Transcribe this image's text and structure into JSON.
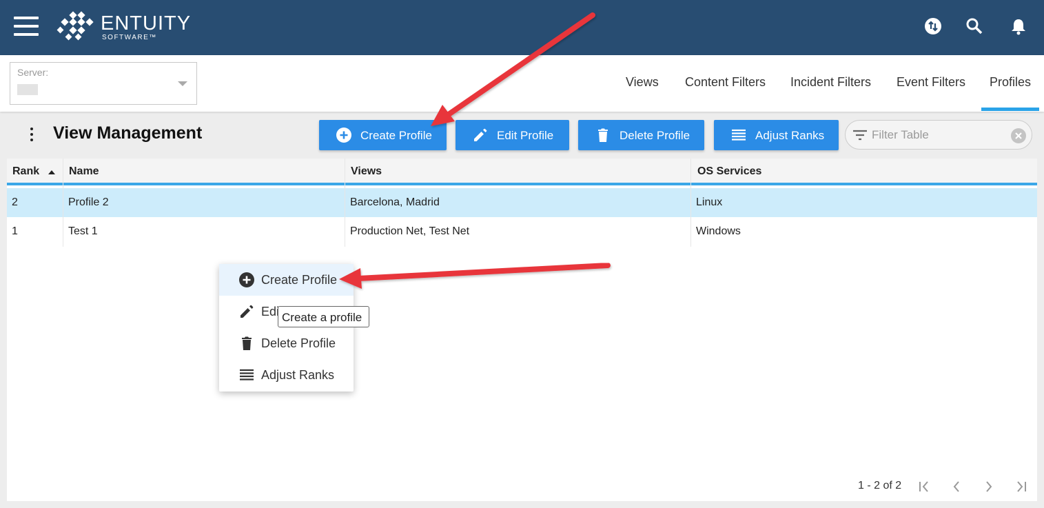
{
  "header": {
    "brand": "ENTUITY",
    "brand_sub": "SOFTWARE™",
    "icons": [
      "menu-icon",
      "sync-icon",
      "search-icon",
      "bell-icon"
    ]
  },
  "server": {
    "label": "Server:"
  },
  "tabs": [
    {
      "label": "Views"
    },
    {
      "label": "Content Filters"
    },
    {
      "label": "Incident Filters"
    },
    {
      "label": "Event Filters"
    },
    {
      "label": "Profiles",
      "active": true
    }
  ],
  "page_title": "View Management",
  "toolbar": {
    "create_label": "Create Profile",
    "edit_label": "Edit Profile",
    "delete_label": "Delete Profile",
    "ranks_label": "Adjust Ranks",
    "filter_placeholder": "Filter Table"
  },
  "table": {
    "columns": [
      "Rank",
      "Name",
      "Views",
      "OS Services"
    ],
    "rows": [
      {
        "rank": "2",
        "name": "Profile 2",
        "views": "Barcelona, Madrid",
        "os": "Linux",
        "selected": true
      },
      {
        "rank": "1",
        "name": "Test 1",
        "views": "Production Net, Test Net",
        "os": "Windows",
        "selected": false
      }
    ]
  },
  "pagination": {
    "text": "1 - 2 of 2"
  },
  "context_menu": {
    "items": [
      {
        "label": "Create Profile",
        "icon": "add-circle-icon"
      },
      {
        "label": "Edi",
        "icon": "pencil-icon"
      },
      {
        "label": "Delete Profile",
        "icon": "trash-icon"
      },
      {
        "label": "Adjust Ranks",
        "icon": "list-icon"
      }
    ]
  },
  "tooltip": "Create a profile",
  "colors": {
    "header_bg": "#284d72",
    "button_bg": "#2b8ce6",
    "selected_row": "#cdecfb",
    "tab_accent": "#2aa3e8",
    "annotation_arrow": "#e8343a"
  }
}
